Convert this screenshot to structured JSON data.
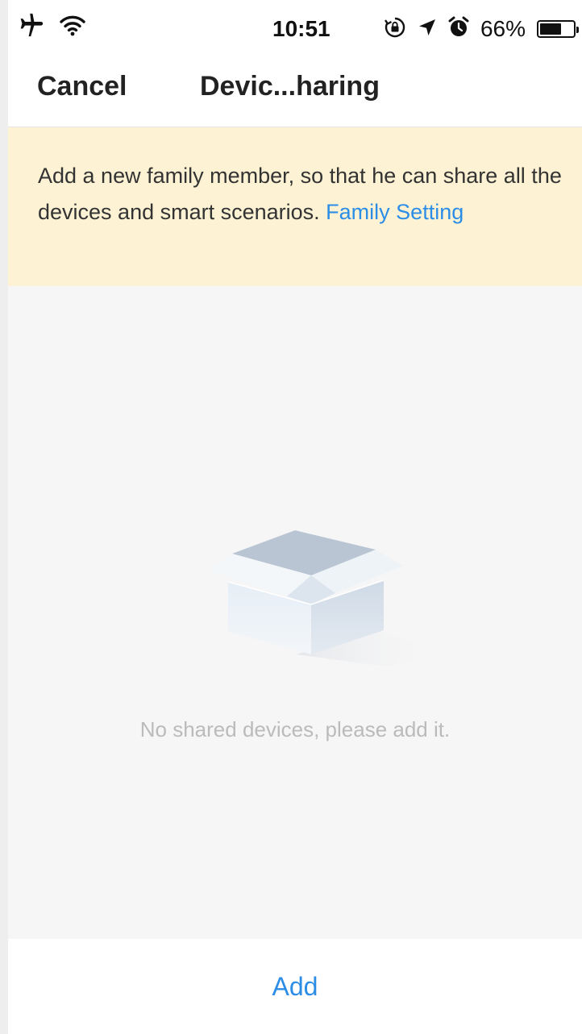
{
  "status_bar": {
    "time": "10:51",
    "battery_percent": "66%",
    "battery_level": 0.66,
    "icons": [
      "airplane-icon",
      "wifi-icon",
      "orientation-lock-icon",
      "location-arrow-icon",
      "alarm-icon",
      "battery-icon"
    ]
  },
  "nav": {
    "cancel_label": "Cancel",
    "title": "Devic...haring"
  },
  "notice": {
    "text": "Add a new family member, so that he can share all the devices and smart scenarios. ",
    "link_label": "Family Setting"
  },
  "empty_state": {
    "icon": "open-box-icon",
    "message": "No shared devices, please add it."
  },
  "bottom": {
    "add_label": "Add"
  },
  "colors": {
    "accent": "#2c8de6",
    "notice_bg": "#fdf3d4",
    "content_bg": "#f6f6f6",
    "empty_text": "#bbbbbb"
  }
}
